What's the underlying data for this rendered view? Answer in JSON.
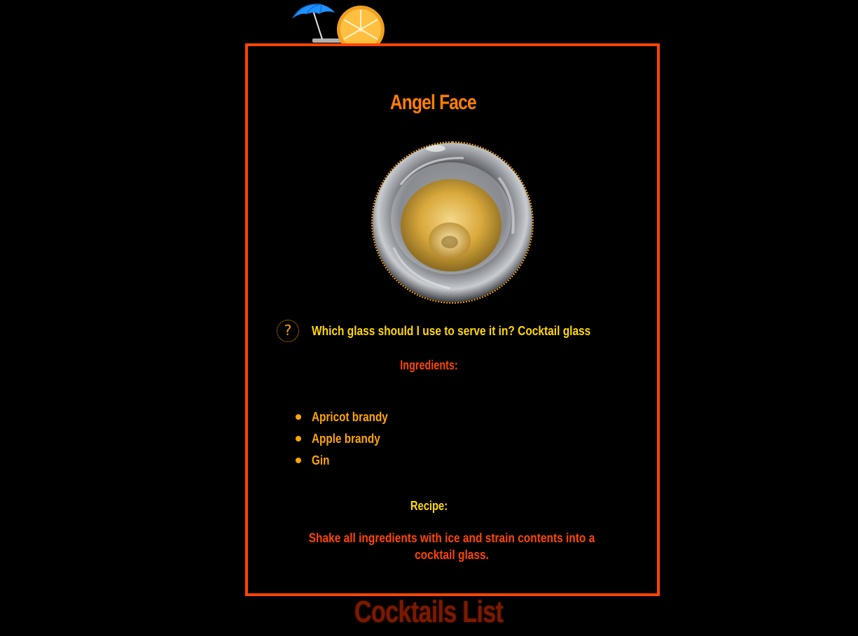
{
  "drink": {
    "name": "Angel Face",
    "glass_question": "Which glass should I use to serve it in? Cocktail glass",
    "ingredients_label": "Ingredients:",
    "ingredients": [
      "Apricot brandy",
      "Apple brandy",
      "Gin"
    ],
    "recipe_label": "Recipe:",
    "recipe": "Shake all ingredients with ice and strain contents into a cocktail glass."
  },
  "help_icon": {
    "glyph": "?",
    "icon": "question-icon"
  },
  "nav": {
    "cocktails_list": "Cocktails List"
  },
  "colors": {
    "background": "#000000",
    "card_border": "#ff4500",
    "title": "#ff7f00",
    "gold": "#ffd700",
    "orange": "#ffa500",
    "red_orange": "#ff4500",
    "footer": "#7a1a00"
  }
}
